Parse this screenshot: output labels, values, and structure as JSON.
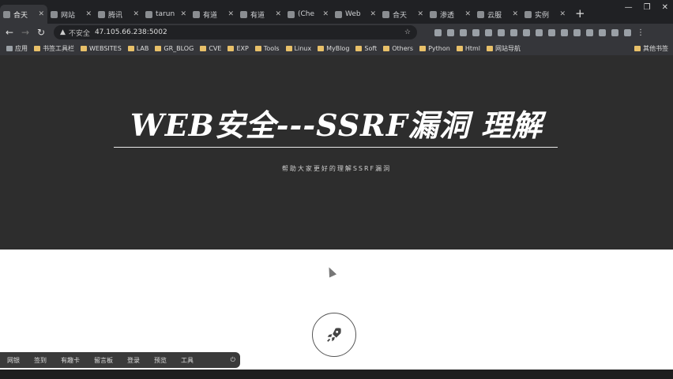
{
  "tabs": [
    {
      "title": "合天",
      "active": true
    },
    {
      "title": "网站",
      "active": false
    },
    {
      "title": "腾讯",
      "active": false
    },
    {
      "title": "tarun",
      "active": false
    },
    {
      "title": "有道",
      "active": false
    },
    {
      "title": "有道",
      "active": false
    },
    {
      "title": "(Che",
      "active": false
    },
    {
      "title": "Web",
      "active": false
    },
    {
      "title": "合天",
      "active": false
    },
    {
      "title": "渗透",
      "active": false
    },
    {
      "title": "云服",
      "active": false
    },
    {
      "title": "实例",
      "active": false
    }
  ],
  "new_tab_label": "+",
  "window_controls": {
    "minimize": "—",
    "maximize": "❐",
    "close": "✕"
  },
  "address": {
    "warning": "▲",
    "insecure": "不安全",
    "url": "47.105.66.238:5002"
  },
  "bookmarks": [
    {
      "label": "应用"
    },
    {
      "label": "书签工具栏"
    },
    {
      "label": "WEBSITES"
    },
    {
      "label": "LAB"
    },
    {
      "label": "GR_BLOG"
    },
    {
      "label": "CVE"
    },
    {
      "label": "EXP"
    },
    {
      "label": "Tools"
    },
    {
      "label": "Linux"
    },
    {
      "label": "MyBlog"
    },
    {
      "label": "Soft"
    },
    {
      "label": "Others"
    },
    {
      "label": "Python"
    },
    {
      "label": "Html"
    },
    {
      "label": "网站导航"
    }
  ],
  "bookmarks_other": "其他书签",
  "hero": {
    "title": "WEB安全---SSRF漏洞 理解",
    "subtitle": "帮助大家更好的理解SSRF漏洞"
  },
  "bottom_bar": {
    "items": [
      "网银",
      "签到",
      "有趣卡",
      "留言板",
      "登录",
      "预览",
      "工具"
    ]
  },
  "colors": {
    "hero_bg": "#2d2d2d",
    "tabbar_bg": "#202124",
    "toolbar_bg": "#35363a"
  }
}
